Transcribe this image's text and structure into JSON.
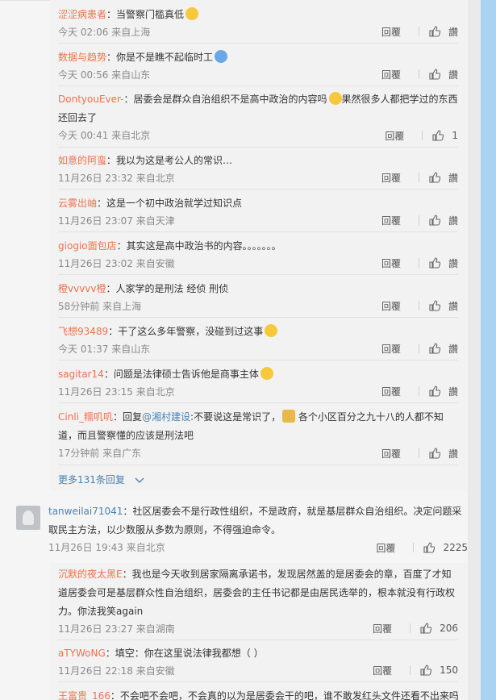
{
  "replies": [
    {
      "user": "涩涩病患者",
      "text": "：当警察门槛真低",
      "meta": "今天 02:06 来自上海",
      "reply": "回覆",
      "like": "讚"
    },
    {
      "user": "数据与趋势",
      "text": "：你是不是瞧不起临时工",
      "meta": "今天 00:56 来自山东",
      "reply": "回覆",
      "like": "讚"
    },
    {
      "user": "DontyouEver-",
      "text": "：居委会是群众自治组织不是高中政治的内容吗",
      "text2": "果然很多人都把学过的东西还回去了",
      "meta": "今天 00:41 来自北京",
      "reply": "回覆",
      "like": "1"
    },
    {
      "user": "如意的阿蛮",
      "text": "：我以为这是考公人的常识…",
      "meta": "11月26日 23:32 来自北京",
      "reply": "回覆",
      "like": "讚"
    },
    {
      "user": "云雾出岫",
      "text": "：这是一个初中政治就学过知识点",
      "meta": "11月26日 23:07 来自天津",
      "reply": "回覆",
      "like": "讚"
    },
    {
      "user": "giogio面包店",
      "text": "：其实这是高中政治书的内容。。。。。。。",
      "meta": "11月26日 23:02 来自安徽",
      "reply": "回覆",
      "like": "讚"
    },
    {
      "user": "橙vvvvv橙",
      "text": "：人家学的是刑法 经侦 刑侦",
      "meta": "58分钟前 来自上海",
      "reply": "回覆",
      "like": "讚"
    },
    {
      "user": "飞想93489",
      "text": "：干了这么多年警察，没碰到过这事",
      "meta": "今天 01:37 来自山东",
      "reply": "回覆",
      "like": "讚"
    },
    {
      "user": "sagitar14",
      "text": "：问题是法律硕士告诉他是商事主体",
      "meta": "11月26日 23:15 来自北京",
      "reply": "回覆",
      "like": "讚"
    },
    {
      "user": "Cinli_糯叽叽",
      "pre": "：回复",
      "mention": "@湘村建设",
      "text": ":不要说这是常识了，",
      "text2": " 各个小区百分之九十八的人都不知道，而且警察懂的应该是刑法吧",
      "meta": "17分钟前 来自广东",
      "reply": "回覆",
      "like": "讚"
    }
  ],
  "more_replies": "更多131条回复",
  "top_comment": {
    "user": "tanweilai71041",
    "text": "：社区居委会不是行政性组织，不是政府，就是基层群众自治组织。决定问题采取民主方法，以少数服从多数为原则，不得强迫命令。",
    "meta": "11月26日 19:43 来自北京",
    "reply": "回覆",
    "likes": "2225"
  },
  "sub_replies": [
    {
      "user": "沉默的夜太黑E",
      "text": "：我也是今天收到居家隔离承诺书，发现居然盖的是居委会的章，百度了才知道居委会可是基层群众性自治组织，居委会的主任书记都是由居民选举的，根本就没有行政权力。你法我笑again",
      "meta": "11月26日 23:27 来自湖南",
      "reply": "回覆",
      "likes": "206"
    },
    {
      "user": "aTYWoNG",
      "text": "：填空：你在这里说法律我都想（ ）",
      "meta": "11月26日 22:18 来自安徽",
      "reply": "回覆",
      "likes": "150"
    },
    {
      "user": "王富贵_166",
      "text": "：不会吧不会吧，不会真的以为是居委会干的吧，谁不敢发红头文件还看不出来吗"
    }
  ],
  "colors": {
    "username": "#eb7350",
    "link": "#4a82b4",
    "meta": "#8a8a8a"
  }
}
